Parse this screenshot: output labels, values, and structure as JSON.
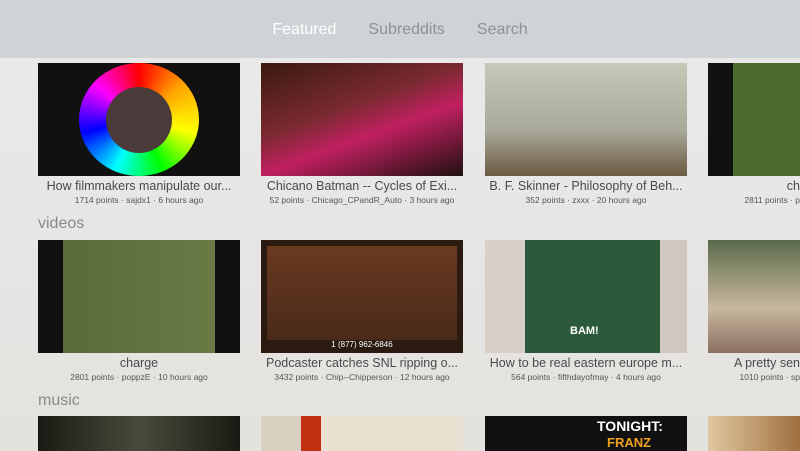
{
  "tabs": [
    {
      "label": "Featured"
    },
    {
      "label": "Subreddits"
    },
    {
      "label": "Search"
    }
  ],
  "sections": [
    {
      "label": "",
      "items": [
        {
          "title": "How filmmakers manipulate our...",
          "meta": "1714 points · sajdx1 · 6 hours ago"
        },
        {
          "title": "Chicano Batman -- Cycles of Exi...",
          "meta": "52 points · Chicago_CPandR_Auto · 3 hours ago"
        },
        {
          "title": "B. F. Skinner - Philosophy of Beh...",
          "meta": "352 points · zxxx · 20 hours ago"
        },
        {
          "title": "ch",
          "meta": "2811 points · p"
        }
      ]
    },
    {
      "label": "videos",
      "items": [
        {
          "title": "charge",
          "meta": "2801 points · poppzE · 10 hours ago"
        },
        {
          "title": "Podcaster catches SNL ripping o...",
          "meta": "3432 points · Chip--Chipperson · 12 hours ago"
        },
        {
          "title": "How to be real eastern europe m...",
          "meta": "564 points · fifthdayofmay · 4 hours ago"
        },
        {
          "title": "A pretty sen",
          "meta": "1010 points · sp"
        }
      ]
    },
    {
      "label": "music",
      "items": [
        {},
        {},
        {
          "overlay": "TONIGHT:",
          "overlay2": "FRANZ"
        },
        {}
      ]
    }
  ],
  "thumb_texts": {
    "phone": "1 (877) 962-6846",
    "bam": "BAM!"
  }
}
